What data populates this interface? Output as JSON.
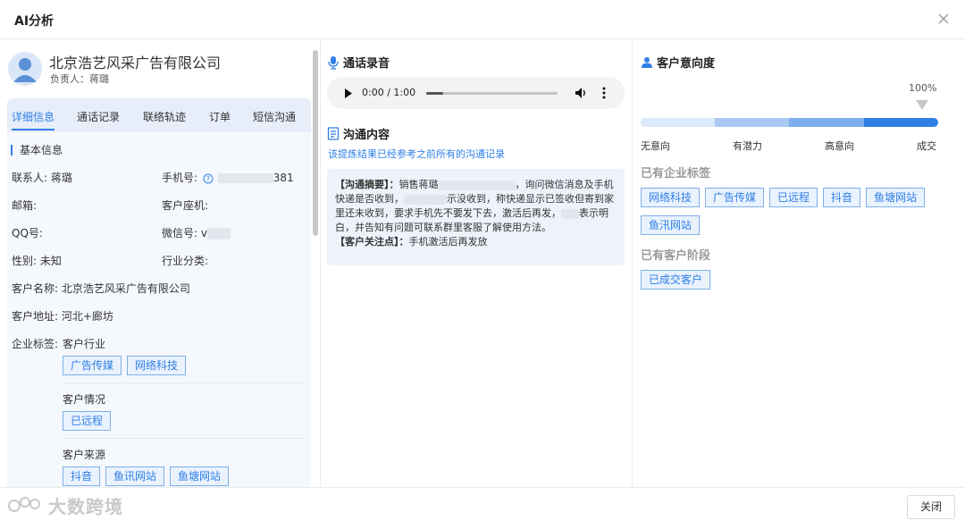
{
  "header": {
    "title": "AI分析"
  },
  "left": {
    "company": "北京浩艺风采广告有限公司",
    "owner_label": "负责人：",
    "owner_name": "蒋璐",
    "tabs": [
      "详细信息",
      "通话记录",
      "联络轨迹",
      "订单",
      "短信沟通"
    ],
    "section_title": "基本信息",
    "fields": {
      "contact": "联系人: 蒋璐",
      "mobile_label": "手机号:",
      "mobile_tail": "381",
      "email": "邮箱:",
      "landline": "客户座机:",
      "qq": "QQ号:",
      "wechat_label": "微信号:",
      "wechat_prefix": "v",
      "gender": "性别: 未知",
      "industry": "行业分类:",
      "customer_name": "客户名称: 北京浩艺风采广告有限公司",
      "address": "客户地址: 河北+廊坊",
      "enterprise_tags_label": "企业标签:"
    },
    "tag_groups": [
      {
        "title": "客户行业",
        "tags": [
          "广告传媒",
          "网络科技"
        ]
      },
      {
        "title": "客户情况",
        "tags": [
          "已远程"
        ]
      },
      {
        "title": "客户来源",
        "tags": [
          "抖音",
          "鱼讯网站",
          "鱼塘网站"
        ]
      }
    ]
  },
  "middle": {
    "recording_title": "通话录音",
    "audio_time": "0:00 / 1:00",
    "audio_progress": 0,
    "content_title": "沟通内容",
    "hint": "该提炼结果已经参考之前所有的沟通记录",
    "summary_label": "【沟通摘要】：",
    "summary_part1": "销售蒋璐",
    "summary_part2": "，询问微信消息及手机快递是否收到，",
    "summary_part3": "示没收到，称快递显示已签收但寄到家里还未收到，要求手机先不要发下去，激活后再发，",
    "summary_part4": "表示明白，并告知有问题可联系群里客服了解使用方法。",
    "focus_label": "【客户关注点】：",
    "focus_text": "手机激活后再发放"
  },
  "right": {
    "intent_title": "客户意向度",
    "intent_percent_label": "100%",
    "intent_value": 1.0,
    "levels": [
      "无意向",
      "有潜力",
      "高意向",
      "成交"
    ],
    "colors": {
      "accent": "#2f7fe6",
      "seg1": "#dce9fa",
      "seg2": "#a9c9f2",
      "seg3": "#7eaeed",
      "seg4": "#2f7fe6"
    },
    "enterprise_tags_title": "已有企业标签",
    "enterprise_tags": [
      "网络科技",
      "广告传媒",
      "已远程",
      "抖音",
      "鱼塘网站",
      "鱼汛网站"
    ],
    "stage_title": "已有客户阶段",
    "stage_tags": [
      "已成交客户"
    ]
  },
  "footer": {
    "close_label": "关闭",
    "watermark": "大数跨境"
  }
}
